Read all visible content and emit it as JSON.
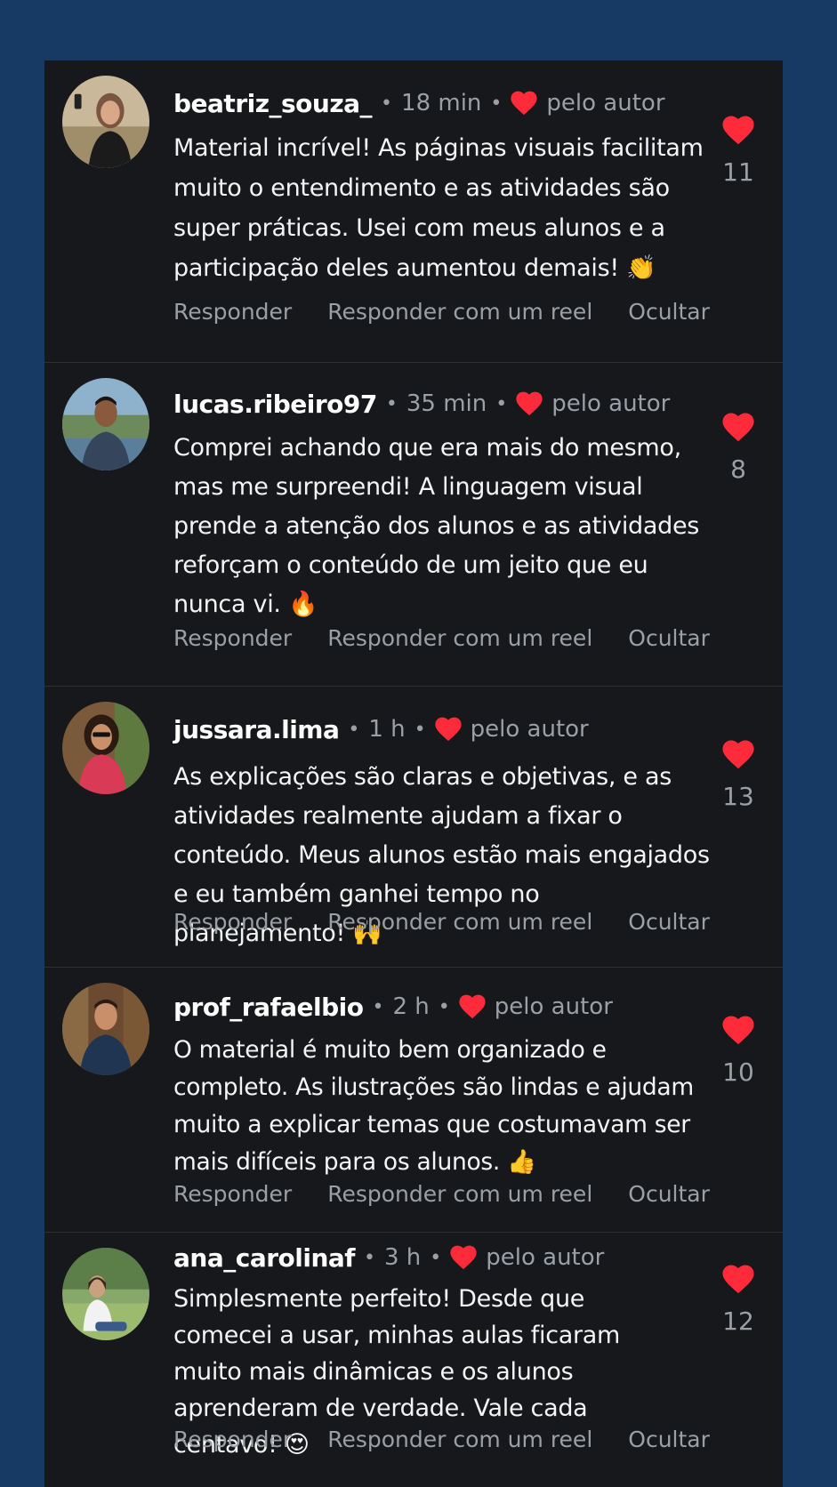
{
  "colors": {
    "background": "#163a63",
    "panel": "#16181b",
    "heart": "#ff2a3a",
    "muted": "#9aa0a6"
  },
  "icons": {
    "author_like": "heart-icon",
    "like_button": "heart-icon"
  },
  "comments": [
    {
      "username": "beatriz_souza_",
      "time": "18 min",
      "by_author": "pelo autor",
      "text": "Material incrível! As páginas visuais facilitam muito o entendimento e as atividades são super práticas. Usei com meus alunos e a participação deles aumentou demais! 👏",
      "likes": "11",
      "actions": [
        "Responder",
        "Responder com um reel",
        "Ocultar"
      ]
    },
    {
      "username": "lucas.ribeiro97",
      "time": "35 min",
      "by_author": "pelo autor",
      "text": "Comprei achando que era mais do mesmo, mas me surpreendi! A linguagem visual prende a atenção dos alunos e as atividades reforçam o conteúdo de um jeito que eu nunca vi. 🔥",
      "likes": "8",
      "actions": [
        "Responder",
        "Responder com um reel",
        "Ocultar"
      ]
    },
    {
      "username": "jussara.lima",
      "time": "1 h",
      "by_author": "pelo autor",
      "text": "As explicações são claras e objetivas, e as atividades realmente ajudam a fixar o conteúdo. Meus alunos estão mais engajados e eu também ganhei tempo no planejamento! 🙌",
      "likes": "13",
      "actions": [
        "Responder",
        "Responder com um reel",
        "Ocultar"
      ]
    },
    {
      "username": "prof_rafaelbio",
      "time": "2 h",
      "by_author": "pelo autor",
      "text": "O material é muito bem organizado e completo. As ilustrações são lindas e ajudam muito a explicar temas que costumavam ser mais difíceis para os alunos. 👍",
      "likes": "10",
      "actions": [
        "Responder",
        "Responder com um reel",
        "Ocultar"
      ]
    },
    {
      "username": "ana_carolinaf",
      "time": "3 h",
      "by_author": "pelo autor",
      "text": "Simplesmente perfeito! Desde que comecei a usar, minhas aulas ficaram muito mais dinâmicas e os alunos aprenderam de verdade. Vale cada centavo! 😍",
      "likes": "12",
      "actions": [
        "Responder",
        "Responder com um reel",
        "Ocultar"
      ]
    }
  ]
}
